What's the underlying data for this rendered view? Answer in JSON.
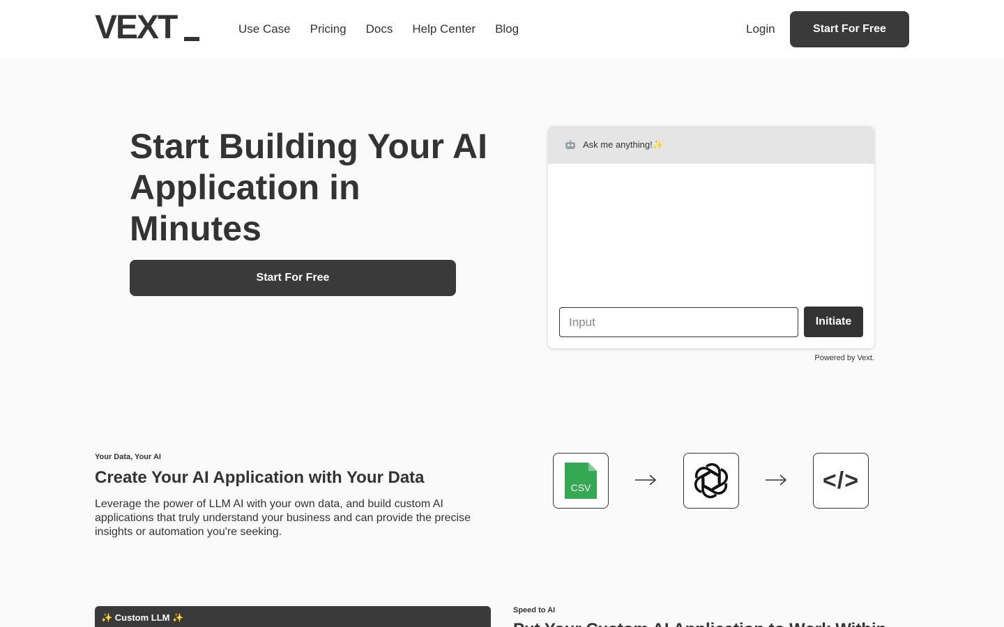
{
  "header": {
    "logo_text": "VEXT",
    "nav": [
      "Use Case",
      "Pricing",
      "Docs",
      "Help Center",
      "Blog"
    ],
    "login_label": "Login",
    "cta_label": "Start For Free"
  },
  "hero": {
    "title": "Start Building Your AI Application in Minutes",
    "cta_label": "Start For Free"
  },
  "chat": {
    "icon": "robot-icon",
    "header_text": "Ask me anything!✨",
    "input_placeholder": "Input",
    "input_value": "",
    "submit_label": "Initiate",
    "powered_by": "Powered by Vext."
  },
  "data_section": {
    "eyebrow": "Your Data, Your AI",
    "title": "Create Your AI Application with Your Data",
    "description": "Leverage the power of LLM AI with your own data, and build custom AI applications that truly understand your business and can provide the precise insights or automation you're seeking.",
    "flow": [
      {
        "icon": "csv-file-icon",
        "label": "CSV"
      },
      {
        "icon": "openai-logo-icon"
      },
      {
        "icon": "code-icon",
        "label": "</>"
      }
    ]
  },
  "custom_llm": {
    "label": "✨ Custom LLM ✨"
  },
  "speed_section": {
    "eyebrow": "Speed to AI",
    "title": "Put Your Custom AI Application to Work Within"
  },
  "colors": {
    "dark": "#3a3a3a",
    "text": "#333333",
    "background": "#fafafa",
    "csv_green": "#34a853"
  }
}
